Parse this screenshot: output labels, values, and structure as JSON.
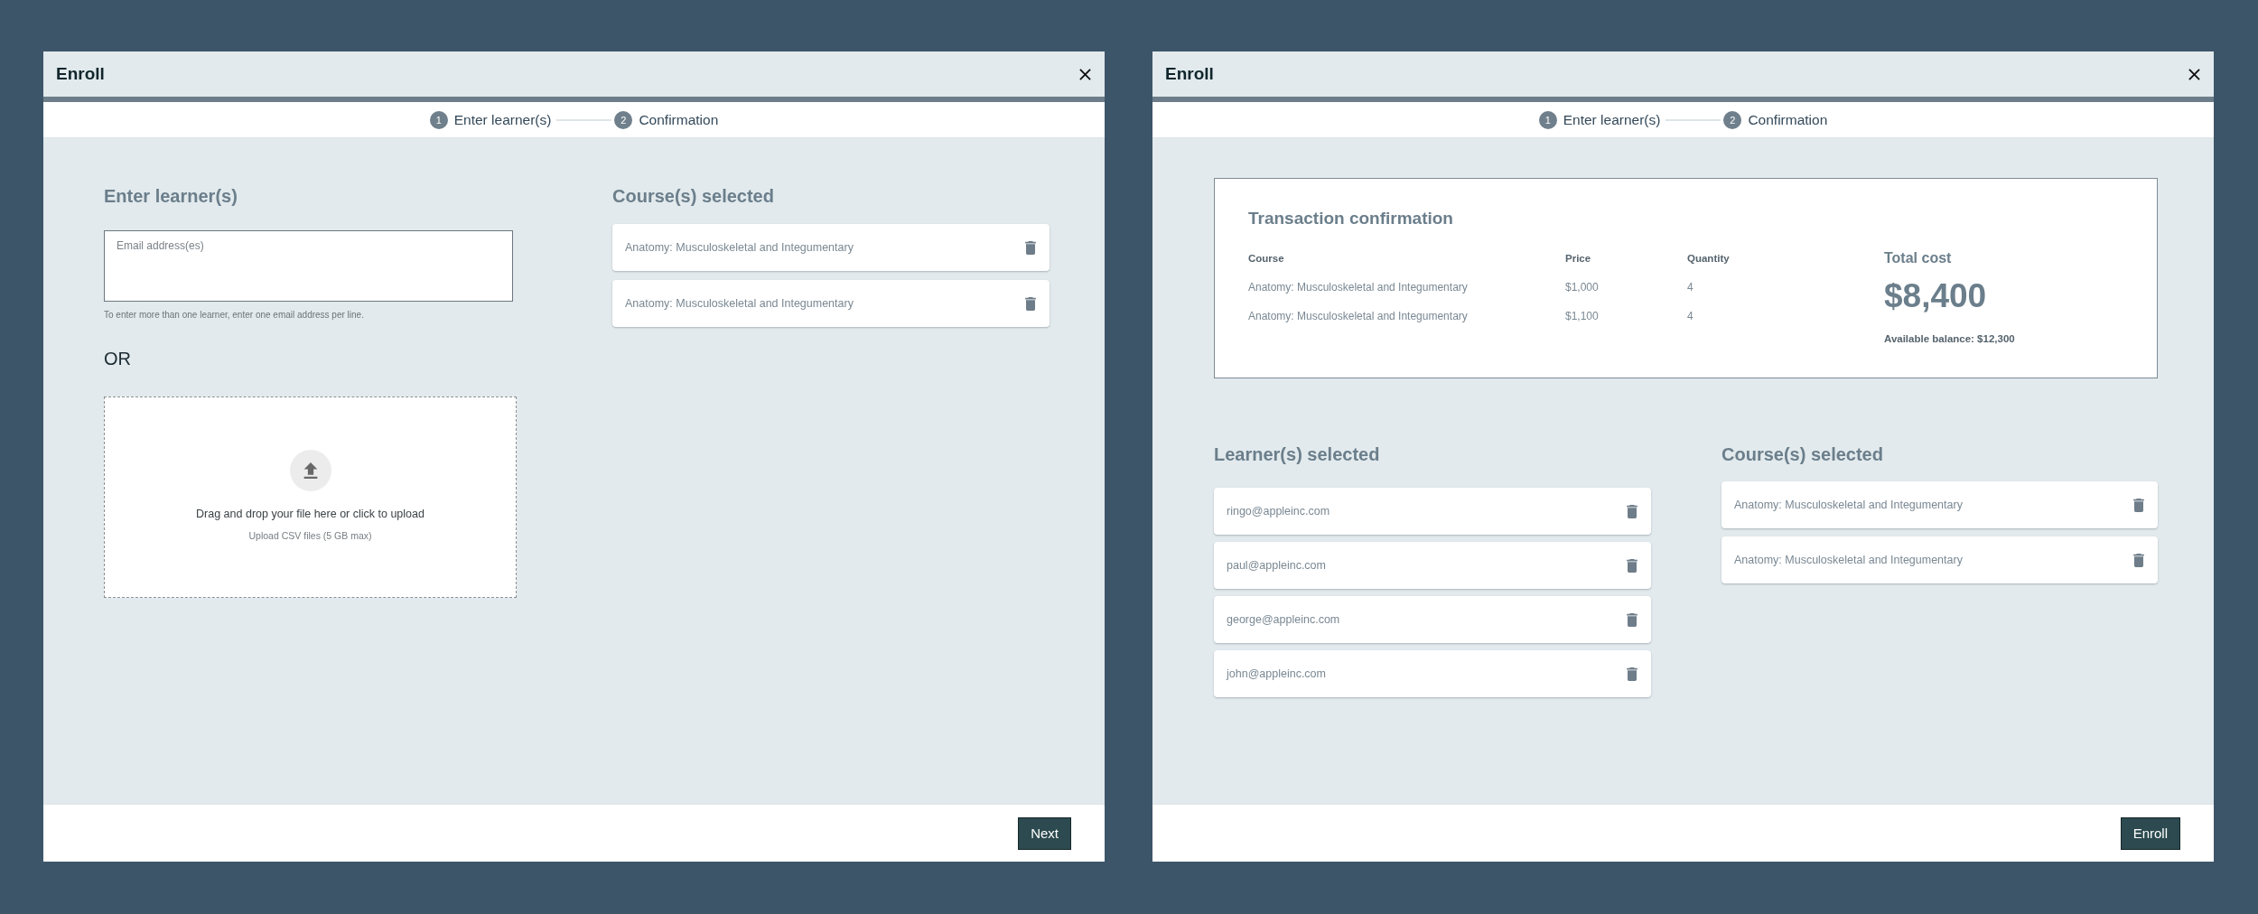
{
  "dialogs": [
    {
      "kind": "enter",
      "title": "Enroll",
      "steps": [
        {
          "number": "1",
          "label": "Enter learner(s)"
        },
        {
          "number": "2",
          "label": "Confirmation"
        }
      ],
      "learner_entry": {
        "heading": "Enter learner(s)",
        "email_field": {
          "placeholder": "Email address(es)"
        },
        "hint": "To enter more than one learner, enter one email address per line.",
        "or_label": "OR",
        "upload": {
          "title": "Drag and drop your file here or click to upload",
          "note": "Upload CSV files (5 GB max)"
        }
      },
      "courses_selected": {
        "heading": "Course(s) selected",
        "items": [
          "Anatomy: Musculoskeletal and Integumentary",
          "Anatomy: Musculoskeletal and Integumentary"
        ]
      },
      "footer_button": "Next"
    },
    {
      "kind": "confirmation",
      "title": "Enroll",
      "steps": [
        {
          "number": "1",
          "label": "Enter learner(s)"
        },
        {
          "number": "2",
          "label": "Confirmation"
        }
      ],
      "transaction": {
        "title": "Transaction confirmation",
        "columns": [
          "Course",
          "Price",
          "Quantity"
        ],
        "rows": [
          [
            "Anatomy: Musculoskeletal and Integumentary",
            "$1,000",
            "4"
          ],
          [
            "Anatomy: Musculoskeletal and Integumentary",
            "$1,100",
            "4"
          ]
        ],
        "total_label": "Total cost",
        "total": "$8,400",
        "balance": "Available balance: $12,300"
      },
      "learners_selected": {
        "heading": "Learner(s) selected",
        "items": [
          "ringo@appleinc.com",
          "paul@appleinc.com",
          "george@appleinc.com",
          "john@appleinc.com"
        ]
      },
      "courses_selected": {
        "heading": "Course(s) selected",
        "items": [
          "Anatomy: Musculoskeletal and Integumentary",
          "Anatomy: Musculoskeletal and Integumentary"
        ]
      },
      "footer_button": "Enroll"
    }
  ]
}
